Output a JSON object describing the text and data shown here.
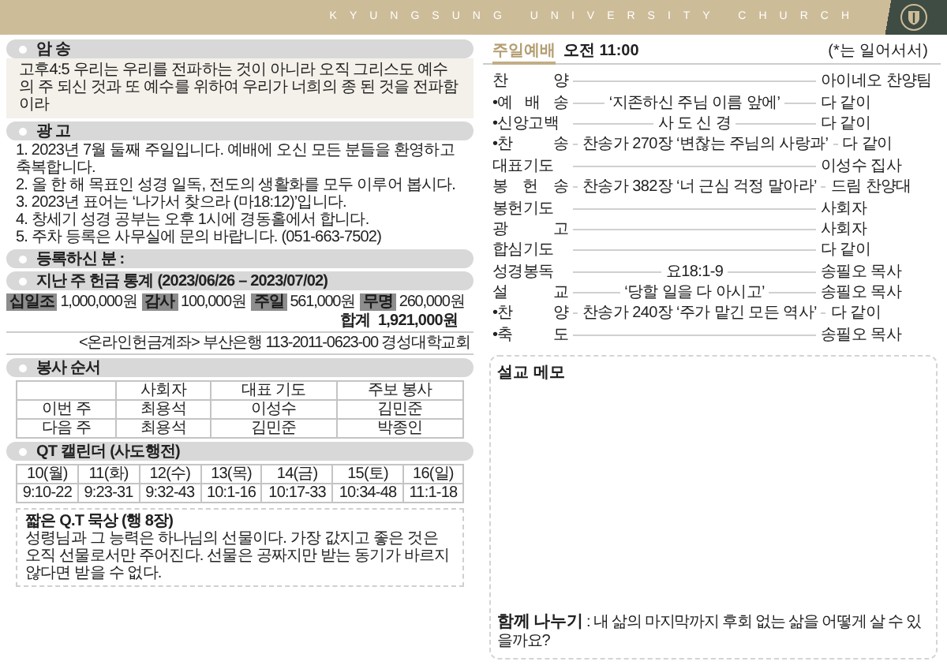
{
  "header": {
    "title": "KYUNGSUNG UNIVERSITY CHURCH"
  },
  "memory_verse": {
    "heading": "암 송",
    "text": "고후4:5 우리는 우리를 전파하는 것이 아니라 오직 그리스도 예수의 주 되신 것과 또 예수를 위하여 우리가 너희의 종 된 것을 전파함이라"
  },
  "announcements": {
    "heading": "광 고",
    "items": [
      "1. 2023년 7월 둘째 주일입니다. 예배에 오신 모든 분들을 환영하고 축복합니다.",
      "2. 올 한 해 목표인 성경 일독, 전도의 생활화를 모두 이루어 봅시다.",
      "3. 2023년 표어는 ‘나가서 찾으라 (마18:12)’입니다.",
      "4. 창세기 성경 공부는 오후 1시에 경동홀에서 합니다.",
      "5. 주차 등록은 사무실에 문의 바랍니다. (051-663-7502)"
    ]
  },
  "newcomers": {
    "heading": "등록하신 분 :"
  },
  "offering": {
    "heading": "지난 주 헌금 통계 (2023/06/26 – 2023/07/02)",
    "items": [
      {
        "label": "십일조",
        "amount": "1,000,000원"
      },
      {
        "label": "감사",
        "amount": "100,000원"
      },
      {
        "label": "주일",
        "amount": "561,000원"
      },
      {
        "label": "무명",
        "amount": "260,000원"
      }
    ],
    "total_label": "합계",
    "total": "1,921,000원",
    "account": "<온라인헌금계좌> 부산은행 113-2011-0623-00 경성대학교회"
  },
  "service_roles": {
    "heading": "봉사 순서",
    "columns": [
      "사회자",
      "대표 기도",
      "주보 봉사"
    ],
    "rows": [
      {
        "week": "이번 주",
        "cells": [
          "최용석",
          "이성수",
          "김민준"
        ]
      },
      {
        "week": "다음 주",
        "cells": [
          "최용석",
          "김민준",
          "박종인"
        ]
      }
    ]
  },
  "qt_calendar": {
    "heading": "QT 캘린더 (사도행전)",
    "days": [
      {
        "day": "10(월)",
        "passage": "9:10-22"
      },
      {
        "day": "11(화)",
        "passage": "9:23-31"
      },
      {
        "day": "12(수)",
        "passage": "9:32-43"
      },
      {
        "day": "13(목)",
        "passage": "10:1-16"
      },
      {
        "day": "14(금)",
        "passage": "10:17-33"
      },
      {
        "day": "15(토)",
        "passage": "10:34-48"
      },
      {
        "day": "16(일)",
        "passage": "11:1-18"
      }
    ]
  },
  "short_qt": {
    "title": "짧은 Q.T 묵상 (행 8장)",
    "text": "성령님과 그 능력은 하나님의 선물이다. 가장 값지고 좋은 것은 오직 선물로서만 주어진다. 선물은 공짜지만 받는 동기가 바르지 않다면 받을 수 없다."
  },
  "worship": {
    "title": "주일예배",
    "time": "오전 11:00",
    "note": "(*는 일어서서)",
    "order": [
      {
        "label": "찬 양",
        "leader": "아이네오 찬양팀"
      },
      {
        "label": "•예 배 송",
        "content": "‘지존하신 주님 이름 앞에’",
        "leader": "다 같이"
      },
      {
        "label": "•신앙고백",
        "content": "사 도 신 경",
        "leader": "다 같이"
      },
      {
        "label": "•찬 송",
        "content": "찬송가 270장 ‘변찮는 주님의 사랑과’",
        "leader": "다 같이"
      },
      {
        "label": "대표기도",
        "leader": "이성수 집사"
      },
      {
        "label": "봉 헌 송",
        "content": "찬송가 382장 ‘너 근심 걱정 말아라’",
        "leader": "드림 찬양대"
      },
      {
        "label": "봉헌기도",
        "leader": "사회자"
      },
      {
        "label": "광 고",
        "leader": "사회자"
      },
      {
        "label": "합심기도",
        "leader": "다 같이"
      },
      {
        "label": "성경봉독",
        "content": "요18:1-9",
        "leader": "송필오 목사"
      },
      {
        "label": "설 교",
        "content": "‘당할 일을 다 아시고’",
        "leader": "송필오 목사"
      },
      {
        "label": "•찬 양",
        "content": "찬송가 240장 ‘주가 맡긴 모든 역사’",
        "leader": "다 같이"
      },
      {
        "label": "•축 도",
        "leader": "송필오 목사"
      }
    ]
  },
  "memo": {
    "title": "설교 메모",
    "share": "**함께 나누기** : 내 삶의 마지막까지 후회 없는 삶을 어떻게 살 수 있을까요?"
  }
}
